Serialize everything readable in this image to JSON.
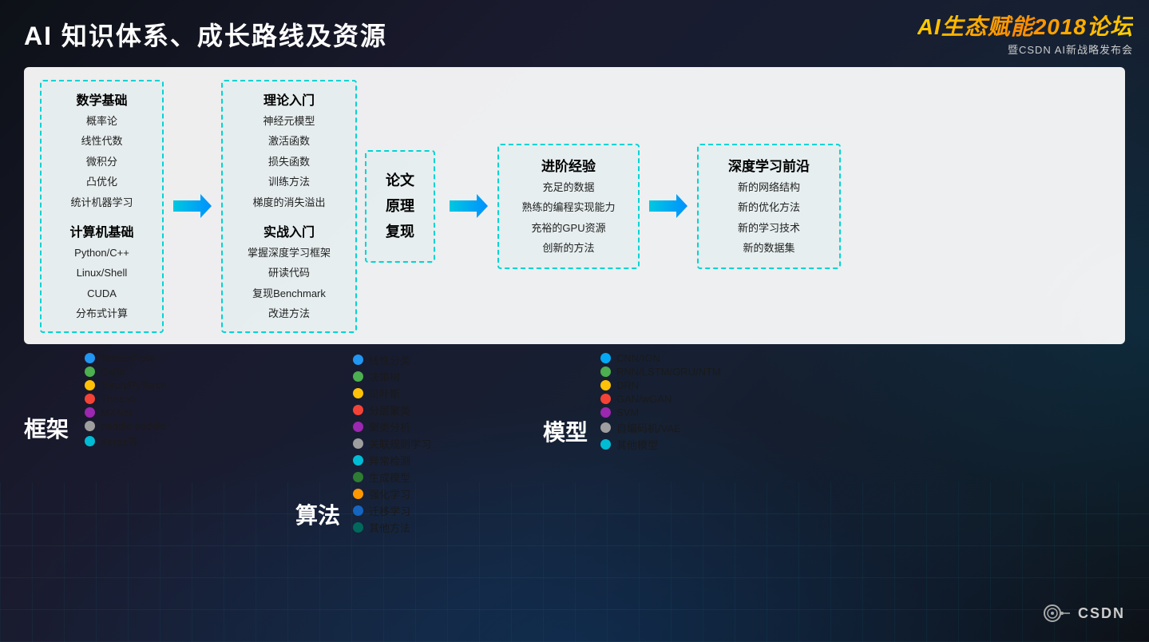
{
  "page": {
    "title": "AI 知识体系、成长路线及资源",
    "logo_main": "AI生态赋能2018论坛",
    "logo_sub": "暨CSDN AI新战略发布会"
  },
  "math_section": {
    "title": "数学基础",
    "items": [
      "概率论",
      "线性代数",
      "微积分",
      "凸优化",
      "统计机器学习"
    ]
  },
  "cs_section": {
    "title": "计算机基础",
    "items": [
      "Python/C++",
      "Linux/Shell",
      "CUDA",
      "分布式计算"
    ]
  },
  "theory_section": {
    "title": "理论入门",
    "items": [
      "神经元模型",
      "激活函数",
      "损失函数",
      "训练方法",
      "梯度的消失溢出"
    ]
  },
  "practice_section": {
    "title": "实战入门",
    "items": [
      "掌握深度学习框架",
      "研读代码",
      "复现Benchmark",
      "改进方法"
    ]
  },
  "paper_section": {
    "title": "论文\n原理\n复现"
  },
  "advanced_section": {
    "title": "进阶经验",
    "items": [
      "充足的数据",
      "熟练的编程实现能力",
      "充裕的GPU资源",
      "创新的方法"
    ]
  },
  "deep_section": {
    "title": "深度学习前沿",
    "items": [
      "新的网络结构",
      "新的优化方法",
      "新的学习技术",
      "新的数据集"
    ]
  },
  "frameworks": {
    "title": "框架",
    "items": [
      {
        "color": "blue",
        "label": "TensorFlow"
      },
      {
        "color": "green",
        "label": "Caffe"
      },
      {
        "color": "yellow",
        "label": "Torch/PyTorch"
      },
      {
        "color": "red",
        "label": "Theano"
      },
      {
        "color": "purple",
        "label": "MXNet"
      },
      {
        "color": "gray",
        "label": "paddle paddle"
      },
      {
        "color": "teal",
        "label": "Keras等"
      }
    ]
  },
  "algorithms": {
    "title": "算法",
    "items": [
      {
        "color": "blue",
        "label": "线性分类"
      },
      {
        "color": "green",
        "label": "决策树"
      },
      {
        "color": "yellow",
        "label": "贝叶斯"
      },
      {
        "color": "red",
        "label": "分层聚类"
      },
      {
        "color": "purple",
        "label": "聚类分析"
      },
      {
        "color": "gray",
        "label": "关联规则学习"
      },
      {
        "color": "teal",
        "label": "异常检测"
      },
      {
        "color": "darkgreen",
        "label": "生成模型"
      },
      {
        "color": "orange",
        "label": "强化学习"
      },
      {
        "color": "darkblue",
        "label": "迁移学习"
      },
      {
        "color": "darkteal",
        "label": "其他方法"
      }
    ]
  },
  "models": {
    "title": "模型",
    "items": [
      {
        "color": "lightblue",
        "label": "CNN/IGN"
      },
      {
        "color": "green",
        "label": "RNN/LSTM/GRU/NTM"
      },
      {
        "color": "yellow",
        "label": "DRN"
      },
      {
        "color": "red",
        "label": "GAN/wGAN"
      },
      {
        "color": "purple",
        "label": "SVM"
      },
      {
        "color": "gray",
        "label": "自编码机/VAE"
      },
      {
        "color": "cyan",
        "label": "其他模型"
      }
    ]
  }
}
